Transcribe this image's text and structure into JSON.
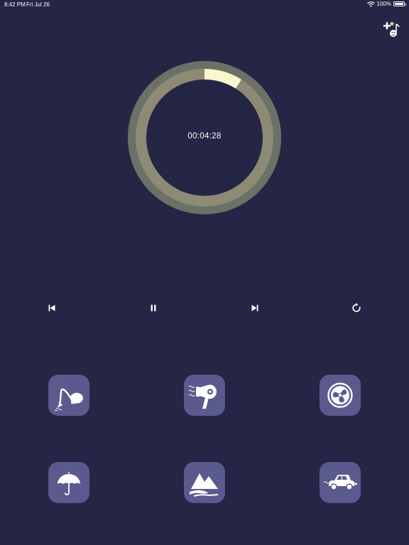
{
  "status_bar": {
    "time": "8:42 PM",
    "date": "Fri Jul 26",
    "battery": "100%"
  },
  "timer": {
    "display": "00:04:28",
    "progress": 0.09
  },
  "colors": {
    "background": "#252545",
    "ring_outer": "#6b7166",
    "ring_track": "#8d8a75",
    "ring_progress": "#fbf6cf",
    "tile": "#5a5a8e"
  },
  "controls": [
    "skip-back-icon",
    "pause-icon",
    "skip-forward-icon",
    "repeat-icon"
  ],
  "sounds": [
    {
      "icon": "vacuum-cleaner-icon"
    },
    {
      "icon": "hair-dryer-icon"
    },
    {
      "icon": "fan-icon"
    },
    {
      "icon": "umbrella-rain-icon"
    },
    {
      "icon": "mountain-stream-icon"
    },
    {
      "icon": "car-icon"
    }
  ]
}
